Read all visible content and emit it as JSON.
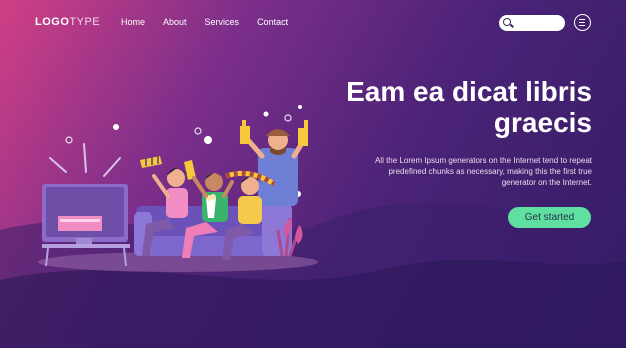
{
  "brand": {
    "logo_bold": "LOGO",
    "logo_light": "TYPE"
  },
  "nav": {
    "items": [
      "Home",
      "About",
      "Services",
      "Contact"
    ]
  },
  "search": {
    "placeholder": ""
  },
  "hero": {
    "title_line1": "Eam ea dicat libris",
    "title_line2": "graecis",
    "body_line1": "All the Lorem Ipsum generators on the Internet tend to repeat",
    "body_line2": "predefined chunks as necessary, making this the first true",
    "body_line3": "generator on the Internet.",
    "cta_label": "Get started"
  },
  "colors": {
    "accent": "#5fe0a1",
    "background_start": "#d13f85",
    "background_end": "#321b63"
  },
  "icons": [
    "search-icon",
    "hamburger-menu-icon"
  ]
}
